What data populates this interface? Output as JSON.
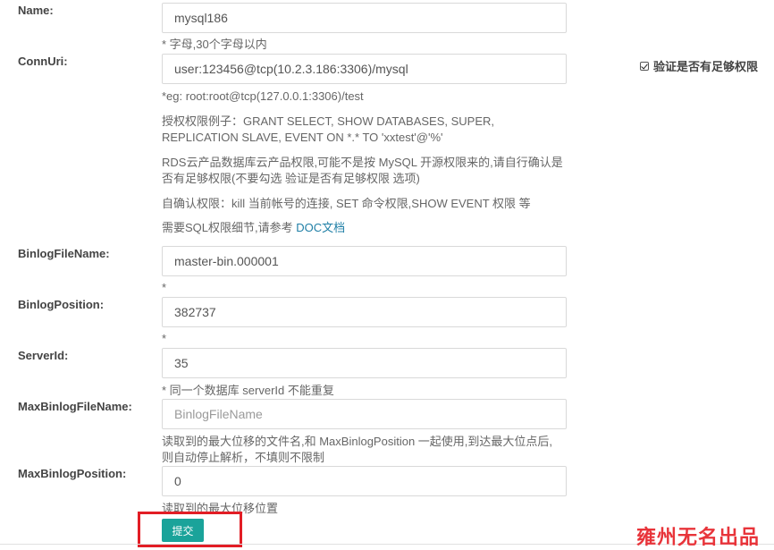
{
  "form": {
    "name": {
      "label": "Name:",
      "value": "mysql186",
      "help": "* 字母,30个字母以内"
    },
    "connuri": {
      "label": "ConnUri:",
      "value": "user:123456@tcp(10.2.3.186:3306)/mysql",
      "help_eg": "*eg: root:root@tcp(127.0.0.1:3306)/test",
      "help_grant_1": "授权权限例子：GRANT SELECT, SHOW DATABASES, SUPER,",
      "help_grant_2": "REPLICATION SLAVE, EVENT ON *.* TO 'xxtest'@'%'",
      "help_rds_1": "RDS云产品数据库云产品权限,可能不是按 MySQL 开源权限来的,请自行确认是",
      "help_rds_2": "否有足够权限(不要勾选 验证是否有足够权限 选项)",
      "help_self": "自确认权限：kill 当前帐号的连接, SET 命令权限,SHOW EVENT 权限 等",
      "help_doc_prefix": "需要SQL权限细节,请参考 ",
      "help_doc_link": "DOC文档",
      "verify_checkbox_label": "验证是否有足够权限",
      "verify_checked": true
    },
    "binlog_file_name": {
      "label": "BinlogFileName:",
      "value": "master-bin.000001",
      "help": "*"
    },
    "binlog_position": {
      "label": "BinlogPosition:",
      "value": "382737",
      "help": "*"
    },
    "server_id": {
      "label": "ServerId:",
      "value": "35",
      "help": "* 同一个数据库 serverId 不能重复"
    },
    "max_binlog_file_name": {
      "label": "MaxBinlogFileName:",
      "value": "",
      "placeholder": "BinlogFileName",
      "help_1": "读取到的最大位移的文件名,和 MaxBinlogPosition 一起使用,到达最大位点后,",
      "help_2": "则自动停止解析，不填则不限制"
    },
    "max_binlog_position": {
      "label": "MaxBinlogPosition:",
      "value": "0",
      "help": "读取到的最大位移位置"
    },
    "submit_label": "提交"
  },
  "watermark": "雍州无名出品",
  "colors": {
    "submit_button": "#1aa39a",
    "highlight_box": "#e21d25",
    "link": "#1f7fa6",
    "watermark": "#e8343a"
  }
}
